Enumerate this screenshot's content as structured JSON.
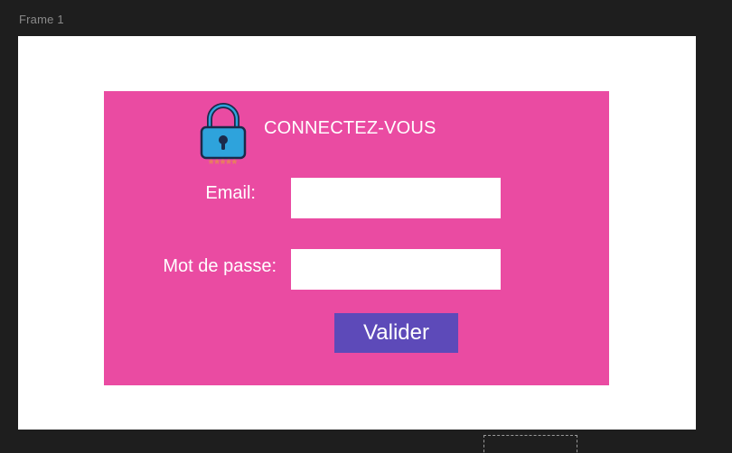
{
  "editor": {
    "frame_label": "Frame 1"
  },
  "login": {
    "heading": "CONNECTEZ-VOUS",
    "email_label": "Email:",
    "password_label": "Mot de passe:",
    "submit_label": "Valider",
    "email_value": "",
    "password_value": "",
    "lock_icon": "lock-icon",
    "colors": {
      "card_bg": "#ea4ba2",
      "button_bg": "#5d4ab9",
      "lock_body": "#2ea3dc",
      "lock_outline": "#1b2a4a",
      "asterisks": "#e8825a"
    }
  }
}
